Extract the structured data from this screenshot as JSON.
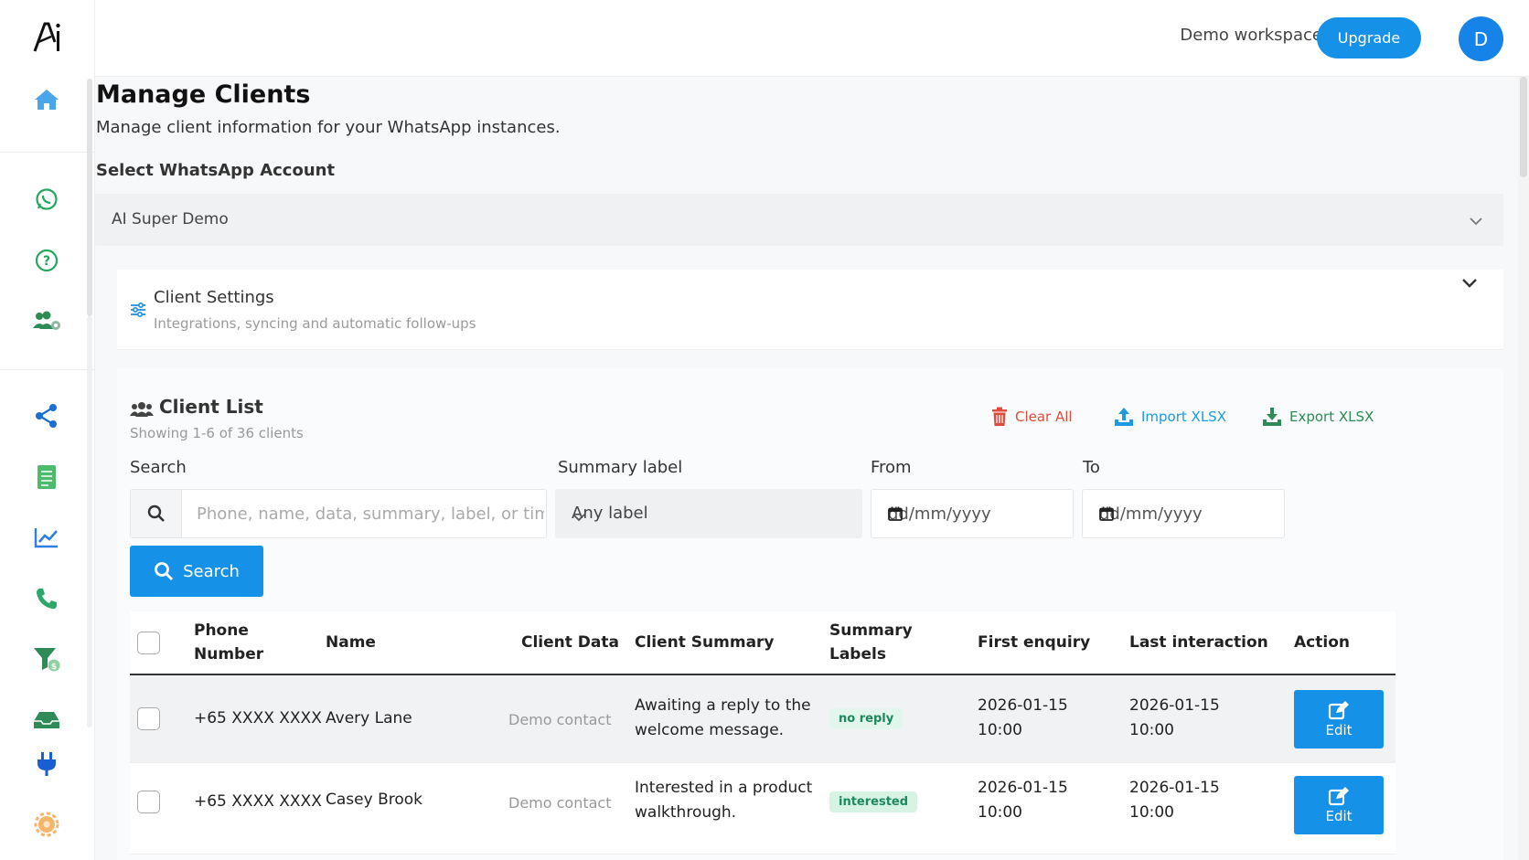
{
  "topbar": {
    "workspace": "Demo workspace",
    "upgrade_label": "Upgrade",
    "avatar_initial": "D"
  },
  "page": {
    "title": "Manage Clients",
    "subtitle": "Manage client information for your WhatsApp instances."
  },
  "account": {
    "label": "Select WhatsApp Account",
    "selected": "AI Super Demo"
  },
  "settings": {
    "title": "Client Settings",
    "subtitle": "Integrations, syncing and automatic follow-ups"
  },
  "client_list": {
    "title": "Client List",
    "showing": "Showing 1-6 of 36 clients",
    "actions": {
      "clear": "Clear All",
      "import": "Import XLSX",
      "export": "Export XLSX"
    }
  },
  "filters": {
    "search_label": "Search",
    "search_placeholder": "Phone, name, data, summary, label, or time",
    "summary_label": "Summary label",
    "summary_value": "Any label",
    "from_label": "From",
    "from_placeholder": "dd/mm/yyyy",
    "to_label": "To",
    "to_placeholder": "dd/mm/yyyy",
    "search_button": "Search"
  },
  "table": {
    "headers": {
      "phone_1": "Phone",
      "phone_2": "Number",
      "name": "Name",
      "client_data": "Client Data",
      "client_summary": "Client Summary",
      "labels_1": "Summary",
      "labels_2": "Labels",
      "first": "First enquiry",
      "last": "Last interaction",
      "action": "Action"
    },
    "rows": [
      {
        "phone": "+65 XXXX XXXX",
        "name": "Avery Lane",
        "data": "Demo contact",
        "summary_1": "Awaiting a reply to the",
        "summary_2": "welcome message.",
        "label": "no reply",
        "first_date": "2026-01-15",
        "first_time": "10:00",
        "last_date": "2026-01-15",
        "last_time": "10:00",
        "action": "Edit"
      },
      {
        "phone": "+65 XXXX XXXX",
        "name": "Casey Brook",
        "data": "Demo contact",
        "summary_1": "Interested in a product",
        "summary_2": "walkthrough.",
        "label": "interested",
        "first_date": "2026-01-15",
        "first_time": "10:00",
        "last_date": "2026-01-15",
        "last_time": "10:00",
        "action": "Edit"
      }
    ]
  },
  "colors": {
    "accent": "#1591e8",
    "danger": "#e24b3b",
    "success": "#2e8b57"
  },
  "icons": [
    "logo",
    "home-icon",
    "whatsapp-icon",
    "help-icon",
    "users-gear-icon",
    "share-icon",
    "document-icon",
    "chart-icon",
    "phone-icon",
    "funnel-icon",
    "inbox-icon",
    "plug-icon",
    "gear-icon"
  ]
}
